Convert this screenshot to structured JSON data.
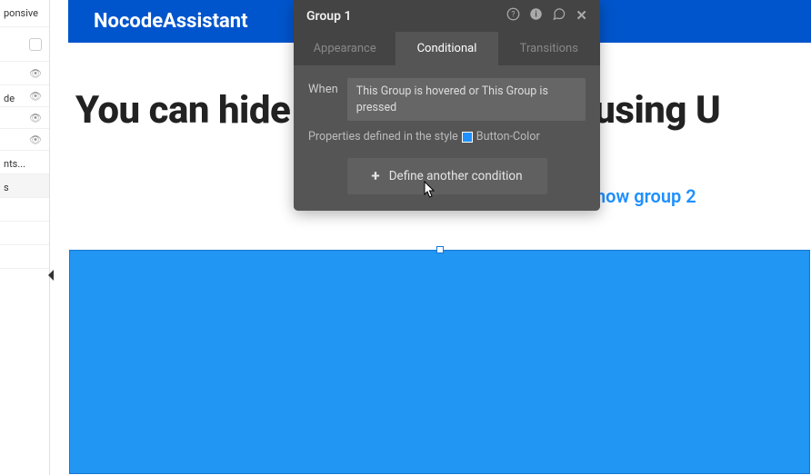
{
  "brand": "NocodeAssistant",
  "sidebar": {
    "items": [
      {
        "label": "ponsive"
      },
      {
        "label": ""
      },
      {
        "label": ""
      },
      {
        "label": ""
      },
      {
        "label": "de"
      },
      {
        "label": ""
      },
      {
        "label": "nts..."
      },
      {
        "label": "s"
      }
    ]
  },
  "canvas": {
    "headline": "You can hide and show groups using U",
    "link_text": "now group 2"
  },
  "popup": {
    "title": "Group 1",
    "tabs": {
      "appearance": "Appearance",
      "conditional": "Conditional",
      "transitions": "Transitions"
    },
    "when_label": "When",
    "condition_expr": "This Group is hovered or This Group is pressed",
    "properties_prefix": "Properties defined in the style",
    "style_name": "Button-Color",
    "add_condition": "Define another condition"
  },
  "colors": {
    "brand_blue": "#0055CC",
    "group_blue": "#2196F3",
    "swatch": "#1E90FF"
  }
}
